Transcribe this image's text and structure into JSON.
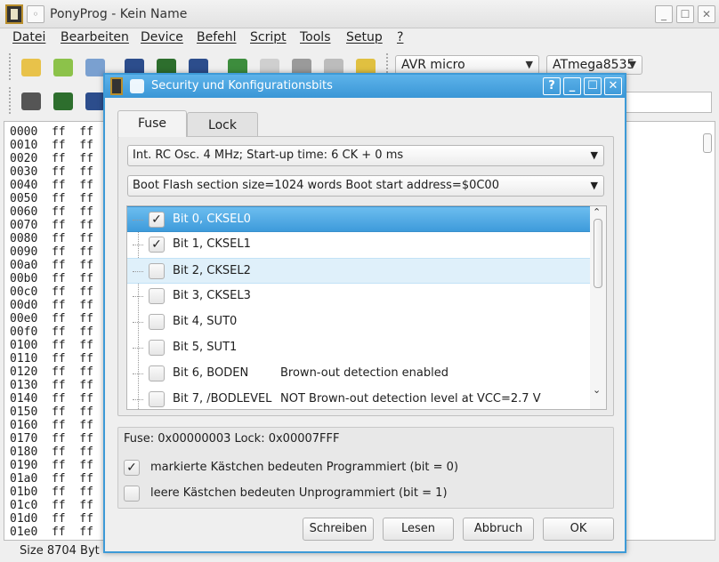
{
  "main_window": {
    "title": "PonyProg - Kein Name",
    "menu": [
      "Datei",
      "Bearbeiten",
      "Device",
      "Befehl",
      "Script",
      "Tools",
      "Setup",
      "?"
    ],
    "device_family": "AVR micro",
    "device_model": "ATmega8535",
    "hex_rows": [
      "0000  ff  ff  ff",
      "0010  ff  ff  ff",
      "0020  ff  ff  ff",
      "0030  ff  ff  ff",
      "0040  ff  ff  ff",
      "0050  ff  ff  ff",
      "0060  ff  ff  ff",
      "0070  ff  ff  ff",
      "0080  ff  ff  ff",
      "0090  ff  ff  ff",
      "00a0  ff  ff  ff",
      "00b0  ff  ff  ff",
      "00c0  ff  ff  ff",
      "00d0  ff  ff  ff",
      "00e0  ff  ff  ff",
      "00f0  ff  ff  ff",
      "0100  ff  ff  ff",
      "0110  ff  ff  ff",
      "0120  ff  ff  ff",
      "0130  ff  ff  ff",
      "0140  ff  ff  ff",
      "0150  ff  ff  ff",
      "0160  ff  ff  ff",
      "0170  ff  ff  ff",
      "0180  ff  ff  ff",
      "0190  ff  ff  ff",
      "01a0  ff  ff  ff",
      "01b0  ff  ff  ff",
      "01c0  ff  ff  ff",
      "01d0  ff  ff  ff",
      "01e0  ff  ff  ff"
    ],
    "status_text": "Size  8704 Byt"
  },
  "dialog": {
    "title": "Security und Konfigurationsbits",
    "help_label": "?",
    "minimize_label": "_",
    "maximize_label": "☐",
    "close_label": "✕",
    "tabs": [
      "Fuse",
      "Lock"
    ],
    "combo_oscillator": "Int. RC Osc. 4 MHz; Start-up time: 6 CK + 0 ms",
    "combo_boot": "Boot Flash section size=1024 words Boot start address=$0C00",
    "bits": [
      {
        "label": "Bit 0, CKSEL0",
        "desc": "",
        "checked": true
      },
      {
        "label": "Bit 1, CKSEL1",
        "desc": "",
        "checked": true
      },
      {
        "label": "Bit 2, CKSEL2",
        "desc": "",
        "checked": false
      },
      {
        "label": "Bit 3, CKSEL3",
        "desc": "",
        "checked": false
      },
      {
        "label": "Bit 4, SUT0",
        "desc": "",
        "checked": false
      },
      {
        "label": "Bit 5, SUT1",
        "desc": "",
        "checked": false
      },
      {
        "label": "Bit 6, BODEN",
        "desc": "Brown-out detection enabled",
        "checked": false
      },
      {
        "label": "Bit 7, /BODLEVEL",
        "desc": "NOT Brown-out detection level at VCC=2.7 V",
        "checked": false
      }
    ],
    "info": "Fuse: 0x00000003 Lock: 0x00007FFF",
    "option_programmed": "markierte Kästchen bedeuten Programmiert (bit = 0)",
    "option_unprogrammed": "leere Kästchen bedeuten Unprogrammiert (bit = 1)",
    "buttons": {
      "write": "Schreiben",
      "read": "Lesen",
      "cancel": "Abbruch",
      "ok": "OK"
    },
    "check_mark": "✓"
  },
  "colors": {
    "accent": "#3d9ad7",
    "selection": "#4aa6e2",
    "hover": "#dff0fa"
  }
}
